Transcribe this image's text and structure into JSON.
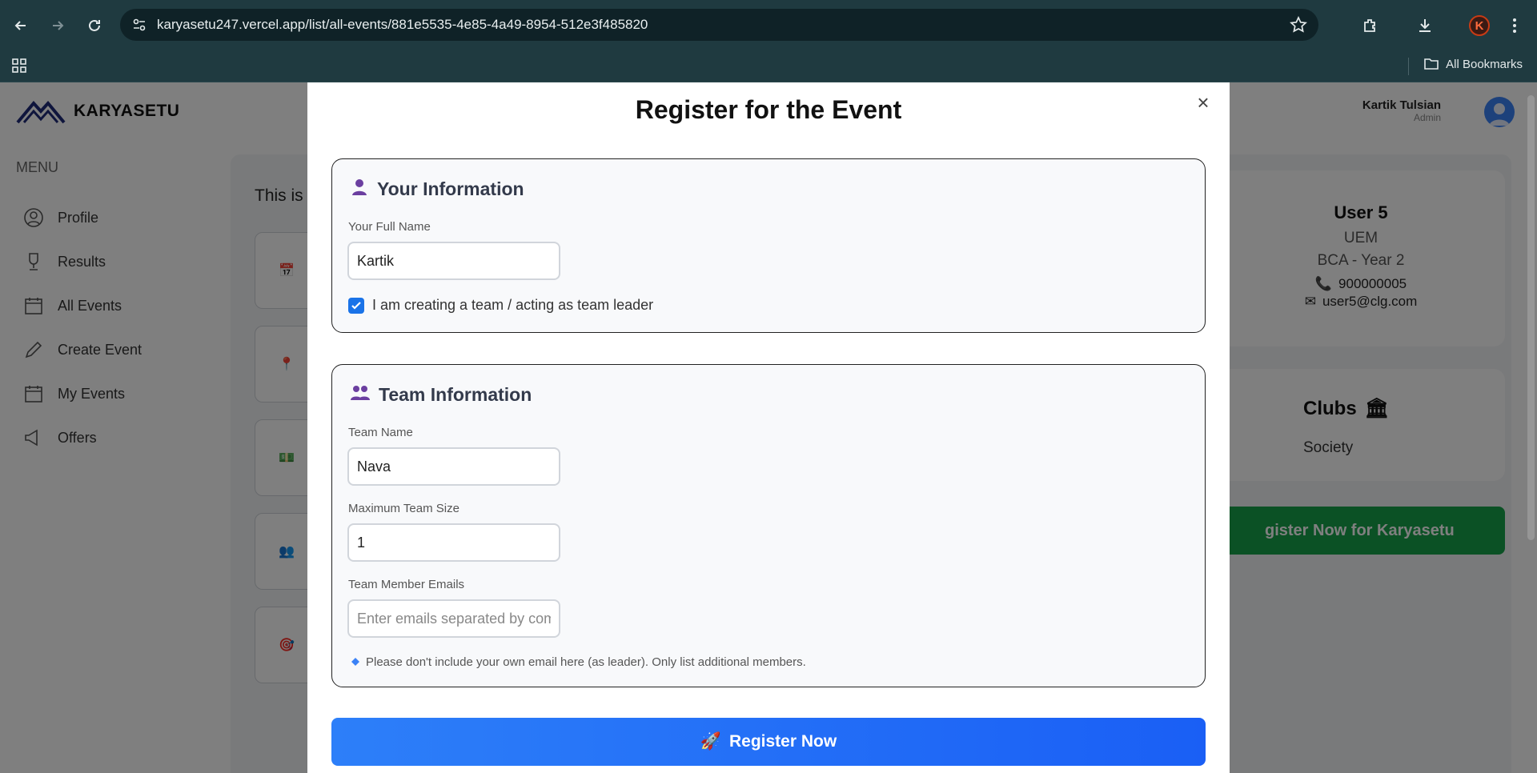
{
  "browser": {
    "url": "karyasetu247.vercel.app/list/all-events/881e5535-4e85-4a49-8954-512e3f485820",
    "bookmarks_label": "All Bookmarks",
    "profile_initial": "K"
  },
  "app": {
    "logo_text": "KARYASETU",
    "menu_heading": "MENU",
    "menu_items": [
      {
        "label": "Profile",
        "icon": "user-circle-icon"
      },
      {
        "label": "Results",
        "icon": "trophy-icon"
      },
      {
        "label": "All Events",
        "icon": "calendar-icon"
      },
      {
        "label": "Create Event",
        "icon": "pencil-icon"
      },
      {
        "label": "My Events",
        "icon": "calendar-icon"
      },
      {
        "label": "Offers",
        "icon": "megaphone-icon"
      }
    ],
    "main_text": "This is",
    "header_user": {
      "name": "Kartik Tulsian",
      "role": "Admin"
    },
    "profile": {
      "name": "User 5",
      "org": "UEM",
      "course": "BCA - Year 2",
      "phone": "900000005",
      "email": "user5@clg.com"
    },
    "clubs": {
      "title": "Clubs",
      "item": "Society"
    },
    "register_cta": "gister Now for Karyasetu"
  },
  "modal": {
    "title": "Register for the Event",
    "close_label": "×",
    "your_info": {
      "title": "Your Information",
      "full_name_label": "Your Full Name",
      "full_name_value": "Kartik",
      "team_leader_label": "I am creating a team / acting as team leader",
      "team_leader_checked": true
    },
    "team_info": {
      "title": "Team Information",
      "team_name_label": "Team Name",
      "team_name_value": "Nava",
      "max_size_label": "Maximum Team Size",
      "max_size_value": "1",
      "emails_label": "Team Member Emails",
      "emails_placeholder": "Enter emails separated by commas",
      "note": "Please don't include your own email here (as leader). Only list additional members."
    },
    "submit_label": "Register Now"
  },
  "colors": {
    "accent": "#1a73e8",
    "register_button": "#1f6cf7",
    "green_button": "#16a34a",
    "overlay": "rgba(0,0,0,0.5)"
  }
}
